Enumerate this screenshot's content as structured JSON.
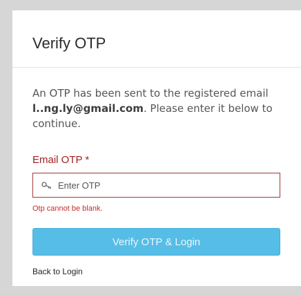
{
  "modal": {
    "title": "Verify OTP",
    "message_prefix": "An OTP has been sent to the registered email ",
    "message_email": "l..ng.ly@gmail.com",
    "message_suffix": ". Please enter it below to continue.",
    "otp_label": "Email OTP *",
    "otp_placeholder": "Enter OTP",
    "otp_value": "",
    "otp_error": "Otp cannot be blank.",
    "verify_button": "Verify OTP & Login",
    "back_link": "Back to Login"
  },
  "colors": {
    "accent_button": "#56bde6",
    "label_red": "#a01f1f",
    "error_red": "#c42b2b",
    "input_border": "#9a3838"
  },
  "icons": {
    "otp_input_icon": "key-icon"
  }
}
